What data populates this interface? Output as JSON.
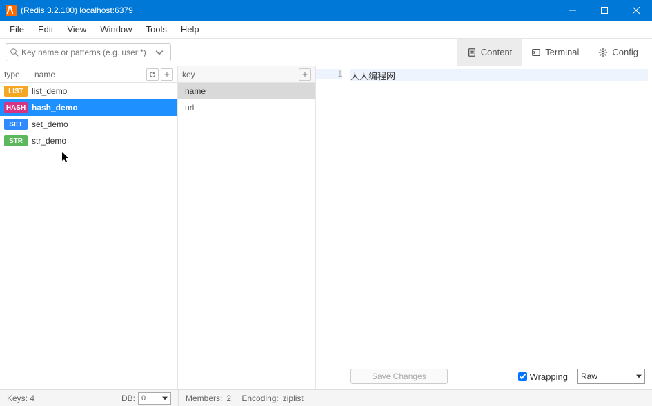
{
  "window": {
    "title": "(Redis 3.2.100) localhost:6379"
  },
  "menu": {
    "file": "File",
    "edit": "Edit",
    "view": "View",
    "window": "Window",
    "tools": "Tools",
    "help": "Help"
  },
  "search": {
    "placeholder": "Key name or patterns (e.g. user:*)"
  },
  "tabs": {
    "content": "Content",
    "terminal": "Terminal",
    "config": "Config"
  },
  "sidebar": {
    "col_type": "type",
    "col_name": "name",
    "keys": [
      {
        "type": "LIST",
        "name": "list_demo",
        "selected": false
      },
      {
        "type": "HASH",
        "name": "hash_demo",
        "selected": true
      },
      {
        "type": "SET",
        "name": "set_demo",
        "selected": false
      },
      {
        "type": "STR",
        "name": "str_demo",
        "selected": false
      }
    ]
  },
  "midpanel": {
    "header": "key",
    "fields": [
      {
        "name": "name",
        "selected": true
      },
      {
        "name": "url",
        "selected": false
      }
    ]
  },
  "editor": {
    "line_no": "1",
    "value": "人人编程网",
    "save_label": "Save Changes",
    "wrapping_label": "Wrapping",
    "wrapping_checked": true,
    "encoding": "Raw"
  },
  "status": {
    "keys_label": "Keys:",
    "keys_count": "4",
    "db_label": "DB:",
    "db_value": "0",
    "members_label": "Members:",
    "members_count": "2",
    "encoding_label": "Encoding:",
    "encoding_value": "ziplist"
  }
}
